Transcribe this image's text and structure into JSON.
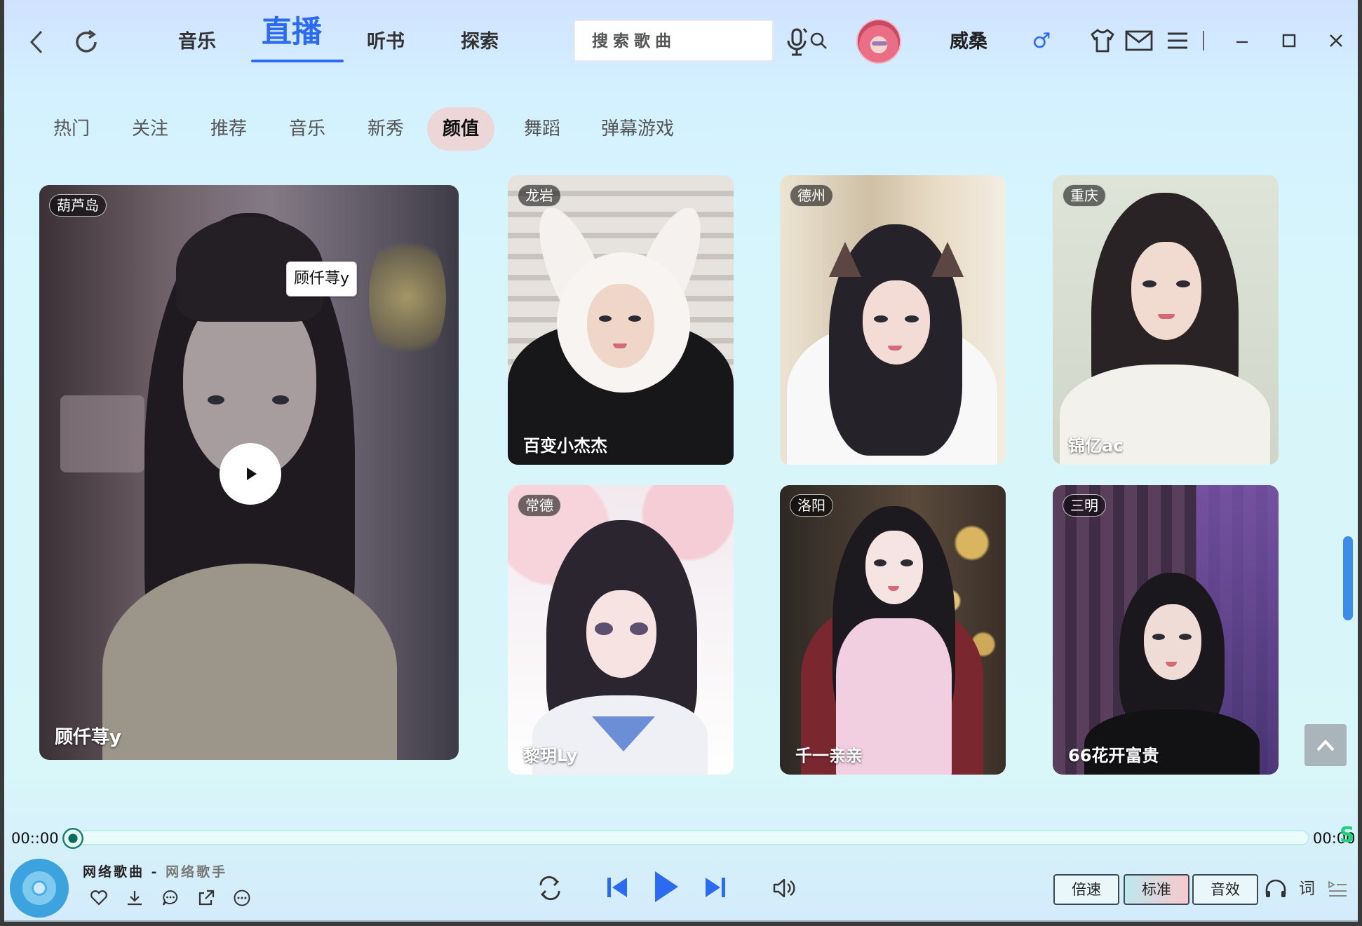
{
  "nav": {
    "tabs": [
      {
        "label": "音乐"
      },
      {
        "label": "直播"
      },
      {
        "label": "听书"
      },
      {
        "label": "探索"
      }
    ]
  },
  "search": {
    "placeholder": "搜索歌曲"
  },
  "user": {
    "name": "威桑",
    "gender_symbol": "♂"
  },
  "categories": [
    {
      "label": "热门"
    },
    {
      "label": "关注"
    },
    {
      "label": "推荐"
    },
    {
      "label": "音乐"
    },
    {
      "label": "新秀"
    },
    {
      "label": "颜值"
    },
    {
      "label": "舞蹈"
    },
    {
      "label": "弹幕游戏"
    }
  ],
  "featured": {
    "location": "葫芦岛",
    "name": "顾仟荨y",
    "tooltip": "顾仟荨y"
  },
  "cards": [
    {
      "location": "龙岩",
      "name": "百变小杰杰"
    },
    {
      "location": "德州",
      "name": ""
    },
    {
      "location": "重庆",
      "name": "锦亿ac"
    },
    {
      "location": "常德",
      "name": "黎玥Ly"
    },
    {
      "location": "洛阳",
      "name": "千一亲亲"
    },
    {
      "location": "三明",
      "name": "66花开富贵"
    }
  ],
  "player": {
    "time_current": "00::00",
    "time_total": "00:00",
    "progress": 0,
    "marker": "S",
    "song_title": "网络歌曲",
    "separator": " - ",
    "artist": "网络歌手",
    "speed_label": "倍速",
    "quality_label": "标准",
    "effect_label": "音效",
    "lyric_label": "词"
  },
  "icons": {
    "back": "chevron-left-icon",
    "refresh": "refresh-icon",
    "search": "search-icon",
    "mic": "microphone-icon",
    "skin": "tshirt-icon",
    "mail": "mail-icon",
    "menu": "menu-icon",
    "minimize": "minimize-icon",
    "maximize": "maximize-icon",
    "close": "close-icon",
    "play": "play-icon"
  },
  "colors": {
    "accent": "#2c6bef",
    "category_active_bg": "#ecd6d7",
    "scrollbar": "#3d8de8"
  }
}
